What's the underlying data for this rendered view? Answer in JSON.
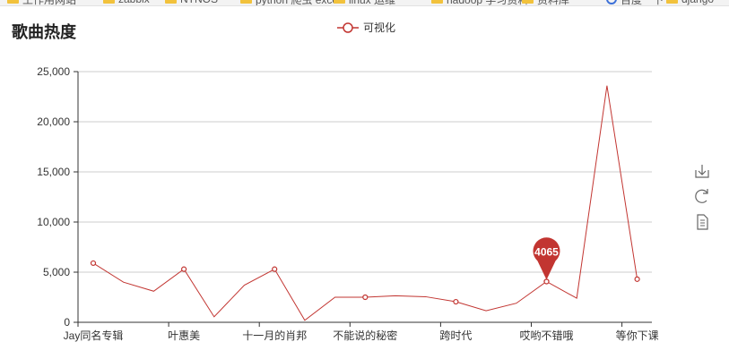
{
  "bookmarks": [
    {
      "label": "工作用网站",
      "icon": "folder-icon"
    },
    {
      "label": "zabbix",
      "icon": "folder-icon"
    },
    {
      "label": "NTNOS",
      "icon": "folder-icon"
    },
    {
      "label": "python 爬虫 excel",
      "icon": "folder-icon"
    },
    {
      "label": "linux 运维",
      "icon": "folder-icon"
    },
    {
      "label": "hadoop 学习资料",
      "icon": "folder-icon"
    },
    {
      "label": "资料库",
      "icon": "folder-icon"
    },
    {
      "label": "百度一下",
      "icon": "browser-icon"
    },
    {
      "label": "django",
      "icon": "folder-icon"
    }
  ],
  "toolbox": {
    "save_icon": "download-icon",
    "refresh_icon": "refresh-icon",
    "data_view_icon": "document-icon"
  },
  "colors": {
    "series": "#c23531",
    "axis": "#333333",
    "grid": "#cccccc"
  },
  "chart_data": {
    "type": "line",
    "title": "歌曲热度",
    "legend": [
      "可视化"
    ],
    "legend_position": "top-center",
    "xlabel": "",
    "ylabel": "",
    "x_tick_labels": [
      "Jay同名专辑",
      "叶惠美",
      "十一月的肖邦",
      "不能说的秘密",
      "跨时代",
      "哎哟不错哦",
      "等你下课"
    ],
    "y_ticks": [
      "0",
      "5,000",
      "10,000",
      "15,000",
      "20,000",
      "25,000"
    ],
    "ylim": [
      0,
      25000
    ],
    "grid": true,
    "series": [
      {
        "name": "可视化",
        "values": [
          5900,
          4000,
          3100,
          5300,
          550,
          3700,
          5300,
          200,
          2500,
          2500,
          2650,
          2550,
          2050,
          1150,
          1900,
          4065,
          2400,
          23600,
          4300
        ]
      }
    ],
    "marked_point": {
      "index": 15,
      "value": 4065,
      "label": "4065"
    }
  }
}
